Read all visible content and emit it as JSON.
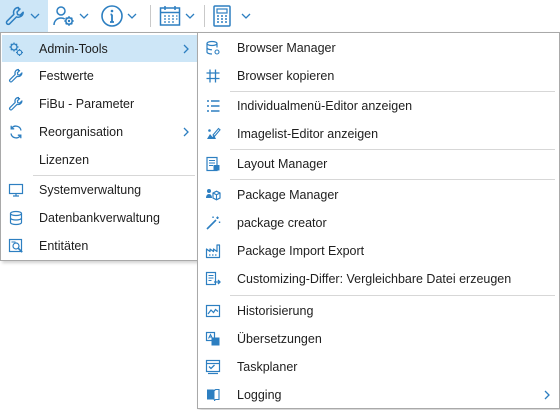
{
  "toolbar": {
    "buttons": [
      {
        "icon": "wrench-icon",
        "has_dropdown": true,
        "active": true
      },
      {
        "icon": "user-settings-icon",
        "has_dropdown": true
      },
      {
        "icon": "info-icon",
        "has_dropdown": true
      },
      {
        "icon": "calendar-icon",
        "has_dropdown": true
      },
      {
        "icon": "calculator-icon",
        "has_dropdown": true
      }
    ]
  },
  "main_menu": {
    "items": [
      {
        "label": "Admin-Tools",
        "icon": "gears-icon",
        "submenu": true,
        "highlighted": true
      },
      {
        "label": "Festwerte",
        "icon": "wrench-icon"
      },
      {
        "label": "FiBu - Parameter",
        "icon": "wrench-icon"
      },
      {
        "label": "Reorganisation",
        "icon": "refresh-icon",
        "submenu": true
      },
      {
        "label": "Lizenzen",
        "icon": ""
      },
      {
        "label": "Systemverwaltung",
        "icon": "monitor-icon"
      },
      {
        "label": "Datenbankverwaltung",
        "icon": "database-icon"
      },
      {
        "label": "Entitäten",
        "icon": "entity-search-icon"
      }
    ]
  },
  "admin_tools_menu": {
    "items": [
      {
        "label": "Browser Manager",
        "icon": "database-settings-icon"
      },
      {
        "label": "Browser kopieren",
        "icon": "grid-icon"
      },
      {
        "label": "Individualmenü-Editor anzeigen",
        "icon": "list-icon"
      },
      {
        "label": "Imagelist-Editor anzeigen",
        "icon": "image-edit-icon"
      },
      {
        "label": "Layout Manager",
        "icon": "layout-icon"
      },
      {
        "label": "Package Manager",
        "icon": "package-user-icon"
      },
      {
        "label": "package creator",
        "icon": "magic-wand-icon"
      },
      {
        "label": "Package Import Export",
        "icon": "factory-icon"
      },
      {
        "label": "Customizing-Differ: Vergleichbare Datei erzeugen",
        "icon": "compare-document-icon"
      },
      {
        "label": "Historisierung",
        "icon": "chart-icon"
      },
      {
        "label": "Übersetzungen",
        "icon": "translate-icon"
      },
      {
        "label": "Taskplaner",
        "icon": "task-scheduler-icon"
      },
      {
        "label": "Logging",
        "icon": "log-book-icon",
        "submenu": true
      }
    ]
  },
  "colors": {
    "accent_blue": "#2d7fc1",
    "highlight": "#cde6f7",
    "border": "#a9a9a9"
  }
}
